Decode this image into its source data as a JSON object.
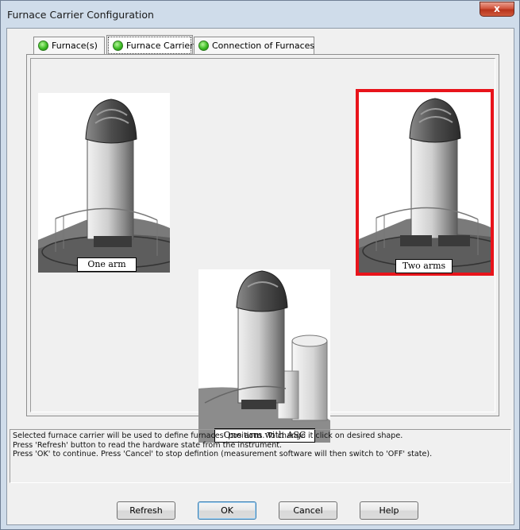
{
  "window": {
    "title": "Furnace Carrier Configuration",
    "close_glyph": "x"
  },
  "tabs": [
    {
      "label": "Furnace(s)",
      "icon": "green-led-icon"
    },
    {
      "label": "Furnace Carrier",
      "icon": "green-led-icon",
      "active": true
    },
    {
      "label": "Connection of Furnaces",
      "icon": "green-led-icon"
    }
  ],
  "carriers": [
    {
      "label": "One arm",
      "selected": false
    },
    {
      "label": "Two arms",
      "selected": true
    },
    {
      "label": "One arm with ASC",
      "selected": false
    }
  ],
  "info_lines": [
    "Selected furnace carrier will be used to define furnaces' positions. To change it click on desired shape.",
    "Press 'Refresh' button to read the hardware state from the instrument.",
    "Press 'OK' to continue. Press 'Cancel' to stop defintion (measurement  software will then switch to 'OFF' state)."
  ],
  "buttons": {
    "refresh": "Refresh",
    "ok": "OK",
    "cancel": "Cancel",
    "help": "Help"
  },
  "colors": {
    "selection": "#e8141b",
    "status_led": "#3dbd25"
  }
}
